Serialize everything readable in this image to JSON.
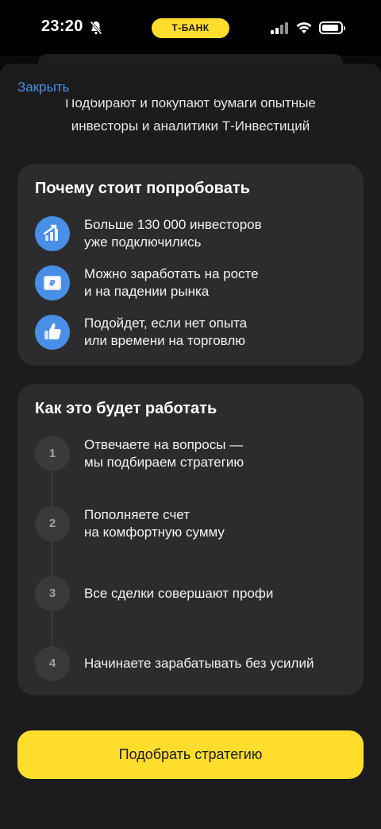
{
  "status_bar": {
    "time": "23:20",
    "bank_badge": "Т-БАНК",
    "icons": [
      "bell-off-icon",
      "signal-icon",
      "wifi-icon",
      "battery-icon"
    ]
  },
  "header": {
    "close_label": "Закрыть",
    "subtitle_line1": "Подбирают и покупают бумаги опытные",
    "subtitle_line2": "инвесторы и аналитики Т-Инвестиций"
  },
  "why_card": {
    "title": "Почему стоит попробовать",
    "items": [
      {
        "icon": "growth-arrow-icon",
        "line1": "Больше 130 000 инвесторов",
        "line2": "уже подключились"
      },
      {
        "icon": "ruble-card-icon",
        "line1": "Можно заработать на росте",
        "line2": "и на падении рынка"
      },
      {
        "icon": "thumbs-up-icon",
        "line1": "Подойдет, если нет опыта",
        "line2": "или времени на торговлю"
      }
    ]
  },
  "how_card": {
    "title": "Как это будет работать",
    "steps": [
      {
        "num": "1",
        "line1": "Отвечаете на вопросы —",
        "line2": "мы подбираем стратегию"
      },
      {
        "num": "2",
        "line1": "Пополняете счет",
        "line2": "на комфортную сумму"
      },
      {
        "num": "3",
        "line1": "Все сделки совершают профи",
        "line2": ""
      },
      {
        "num": "4",
        "line1": "Начинаете зарабатывать без усилий",
        "line2": ""
      }
    ]
  },
  "cta": {
    "label": "Подобрать стратегию"
  },
  "colors": {
    "accent_yellow": "#ffdd2d",
    "link_blue": "#4a90e2",
    "icon_blue": "#4a8fe7",
    "card_bg": "#2c2c2e",
    "sheet_bg": "#1c1c1e"
  }
}
